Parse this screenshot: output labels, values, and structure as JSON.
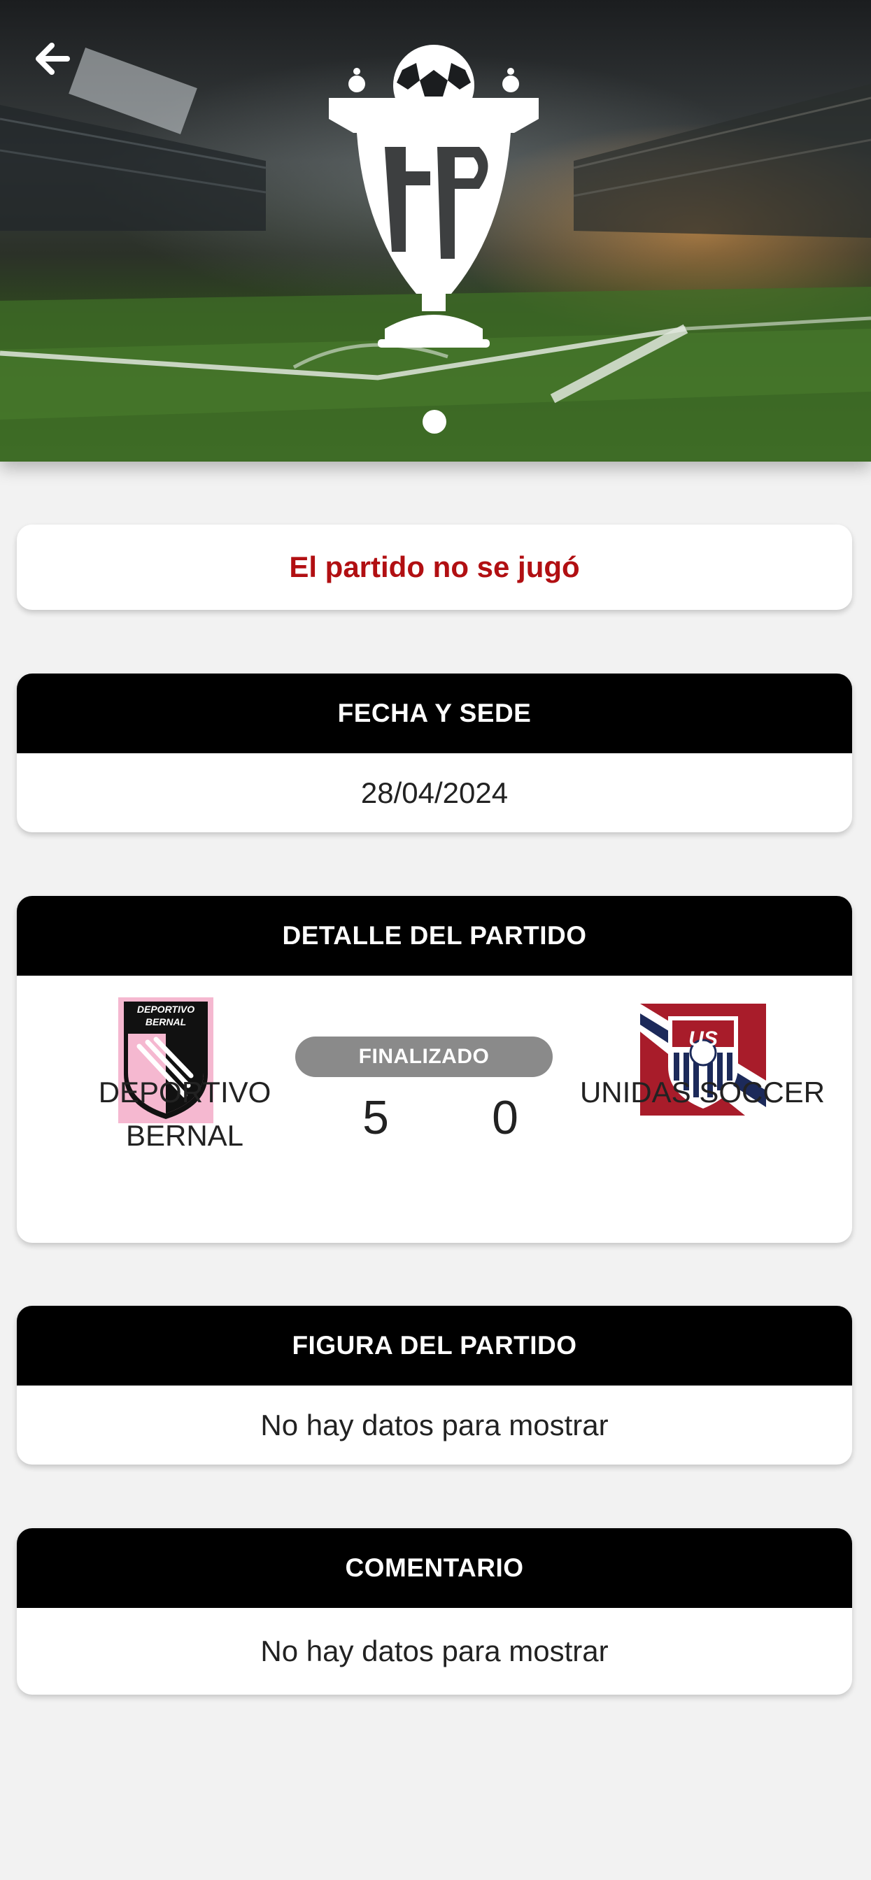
{
  "header": {
    "back_icon": "arrow-left-icon",
    "logo_icon": "fpt-trophy-logo",
    "carousel_dots": 1
  },
  "status": {
    "text": "El partido no se jugó",
    "color": "#b10f12"
  },
  "fecha_sede": {
    "title": "FECHA Y SEDE",
    "date": "28/04/2024"
  },
  "detalle": {
    "title": "DETALLE DEL PARTIDO",
    "status_badge": "FINALIZADO",
    "home": {
      "name": "DEPORTIVO BERNAL",
      "crest_text": "DEPORTIVO BERNAL",
      "score": "5"
    },
    "away": {
      "name": "UNIDAS SOCCER",
      "crest_text": "US",
      "score": "0"
    }
  },
  "figura": {
    "title": "FIGURA DEL PARTIDO",
    "text": "No hay datos para mostrar"
  },
  "comentario": {
    "title": "COMENTARIO",
    "text": "No hay datos para mostrar"
  }
}
